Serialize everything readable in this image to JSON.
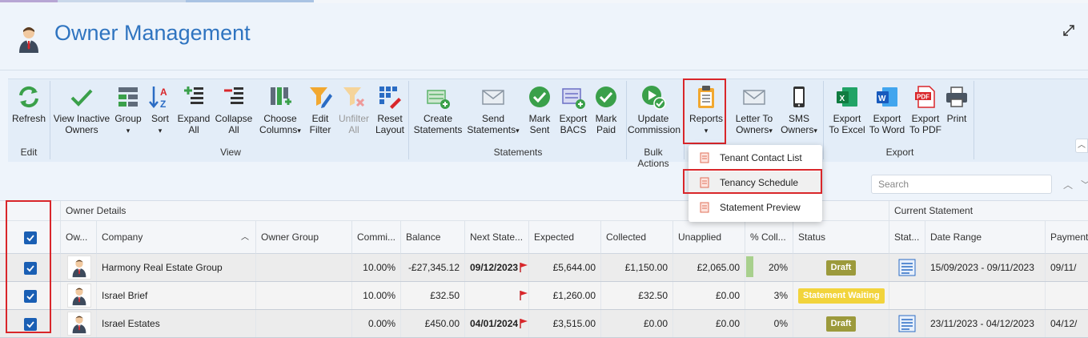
{
  "page": {
    "title": "Owner Management"
  },
  "ribbon": {
    "groups": {
      "edit": "Edit",
      "view": "View",
      "statements": "Statements",
      "bulk_actions": "Bulk Actions",
      "export": "Export"
    },
    "buttons": {
      "refresh": "Refresh",
      "view_inactive_1": "View Inactive",
      "view_inactive_2": "Owners",
      "group": "Group",
      "sort": "Sort",
      "expand_1": "Expand",
      "expand_2": "All",
      "collapse_1": "Collapse",
      "collapse_2": "All",
      "choose_1": "Choose",
      "choose_2": "Columns",
      "edit_filter_1": "Edit",
      "edit_filter_2": "Filter",
      "unfilter_1": "Unfilter",
      "unfilter_2": "All",
      "reset_1": "Reset",
      "reset_2": "Layout",
      "create_1": "Create",
      "create_2": "Statements",
      "send_1": "Send",
      "send_2": "Statements",
      "mark_sent_1": "Mark",
      "mark_sent_2": "Sent",
      "export_bacs_1": "Export",
      "export_bacs_2": "BACS",
      "mark_paid_1": "Mark",
      "mark_paid_2": "Paid",
      "update_comm_1": "Update",
      "update_comm_2": "Commission",
      "reports": "Reports",
      "letter_1": "Letter To",
      "letter_2": "Owners",
      "sms_1": "SMS",
      "sms_2": "Owners",
      "excel_1": "Export",
      "excel_2": "To Excel",
      "word_1": "Export",
      "word_2": "To Word",
      "pdf_1": "Export",
      "pdf_2": "To PDF",
      "print": "Print"
    }
  },
  "reports_menu": {
    "items": [
      "Tenant Contact List",
      "Tenancy Schedule",
      "Statement Preview"
    ]
  },
  "search": {
    "placeholder": "Search"
  },
  "grid": {
    "group_headers": {
      "owner_details": "Owner Details",
      "current_statement": "Current Statement"
    },
    "columns": [
      "Ow...",
      "Company",
      "Owner Group",
      "Commi...",
      "Balance",
      "Next State...",
      "Expected",
      "Collected",
      "Unapplied",
      "% Coll...",
      "Status",
      "Stat...",
      "Date Range",
      "Payment"
    ],
    "rows": [
      {
        "company": "Harmony Real Estate Group",
        "owner_group": "",
        "commission": "10.00%",
        "balance": "-£27,345.12",
        "next_statement": "09/12/2023",
        "expected": "£5,644.00",
        "collected": "£1,150.00",
        "unapplied": "£2,065.00",
        "pct": "20%",
        "pct_value": 0.2,
        "status": "Draft",
        "date_range": "15/09/2023 - 09/11/2023",
        "payment": "09/11/"
      },
      {
        "company": "Israel Brief",
        "owner_group": "",
        "commission": "10.00%",
        "balance": "£32.50",
        "next_statement": "",
        "expected": "£1,260.00",
        "collected": "£32.50",
        "unapplied": "£0.00",
        "pct": "3%",
        "pct_value": 0.03,
        "status": "Statement Waiting",
        "date_range": "",
        "payment": ""
      },
      {
        "company": "Israel Estates",
        "owner_group": "",
        "commission": "0.00%",
        "balance": "£450.00",
        "next_statement": "04/01/2024",
        "expected": "£3,515.00",
        "collected": "£0.00",
        "unapplied": "£0.00",
        "pct": "0%",
        "pct_value": 0,
        "status": "Draft",
        "date_range": "23/11/2023 - 04/12/2023",
        "payment": "04/12/"
      }
    ]
  },
  "colors": {
    "accent": "#2f74c0",
    "draft": "#9c9a3c",
    "waiting": "#f2d43c",
    "checkbox": "#1a5fb4",
    "highlight": "#d9262a"
  }
}
